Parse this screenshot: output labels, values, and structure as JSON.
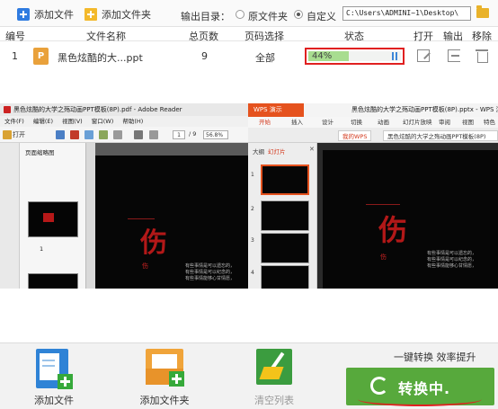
{
  "toolbar": {
    "add_file": "添加文件",
    "add_folder": "添加文件夹",
    "output_dir_label": "输出目录：",
    "option_original": "原文件夹",
    "option_custom": "自定义",
    "path_value": "C:\\Users\\ADMINI~1\\Desktop\\",
    "selected_option": "自定义"
  },
  "table": {
    "headers": [
      "编号",
      "文件名称",
      "总页数",
      "页码选择",
      "状态",
      "打开",
      "输出",
      "移除"
    ],
    "rows": [
      {
        "index": "1",
        "file_type_badge": "P",
        "file_name": "黑色炫酷的大...ppt",
        "total_pages": "9",
        "page_selection": "全部",
        "progress_percent": 44,
        "progress_text": "44%"
      }
    ]
  },
  "preview": {
    "left_window": {
      "title": "黑色炫酷的大学之殇动画PPT模板(8P).pdf - Adobe Reader",
      "menu": [
        "文件(F)",
        "编辑(E)",
        "视图(V)",
        "窗口(W)",
        "帮助(H)"
      ],
      "open_label": "打开",
      "page_current": "1",
      "page_total": "/ 9",
      "zoom": "56.8%",
      "thumbs_title": "页面缩略图",
      "page_number": "1"
    },
    "right_window": {
      "app_name": "WPS 演示",
      "title": "黑色炫酷的大学之殇动画PPT模板(8P).pptx - WPS 演示",
      "menus": [
        "开始",
        "插入",
        "设计",
        "切换",
        "动画",
        "幻灯片放映",
        "审阅",
        "视图",
        "特色"
      ],
      "tabs": [
        "我的WPS",
        "黑色炫酷的大学之殇动画PPT模板(8P)"
      ],
      "side_tab_outline": "大纲",
      "side_tab_slides": "幻灯片",
      "slide_numbers": [
        "1",
        "2",
        "3",
        "4"
      ]
    },
    "slide_calligraphy": "伤",
    "slide_small_calligraphy": "伤",
    "slide_text_lines": [
      "有些事情是可以遗忘的，",
      "有些事情是可以纪念的，",
      "有些事情能够心甘情愿，"
    ]
  },
  "bottom": {
    "add_file": "添加文件",
    "add_folder": "添加文件夹",
    "clear_list": "清空列表",
    "slogan": "一键转换 效率提升",
    "convert_label": "转换中."
  },
  "colors": {
    "accent_green": "#57a93c",
    "progress_fill": "#a8dd90",
    "highlight_red": "#e02020",
    "wps_orange": "#e5521e"
  }
}
